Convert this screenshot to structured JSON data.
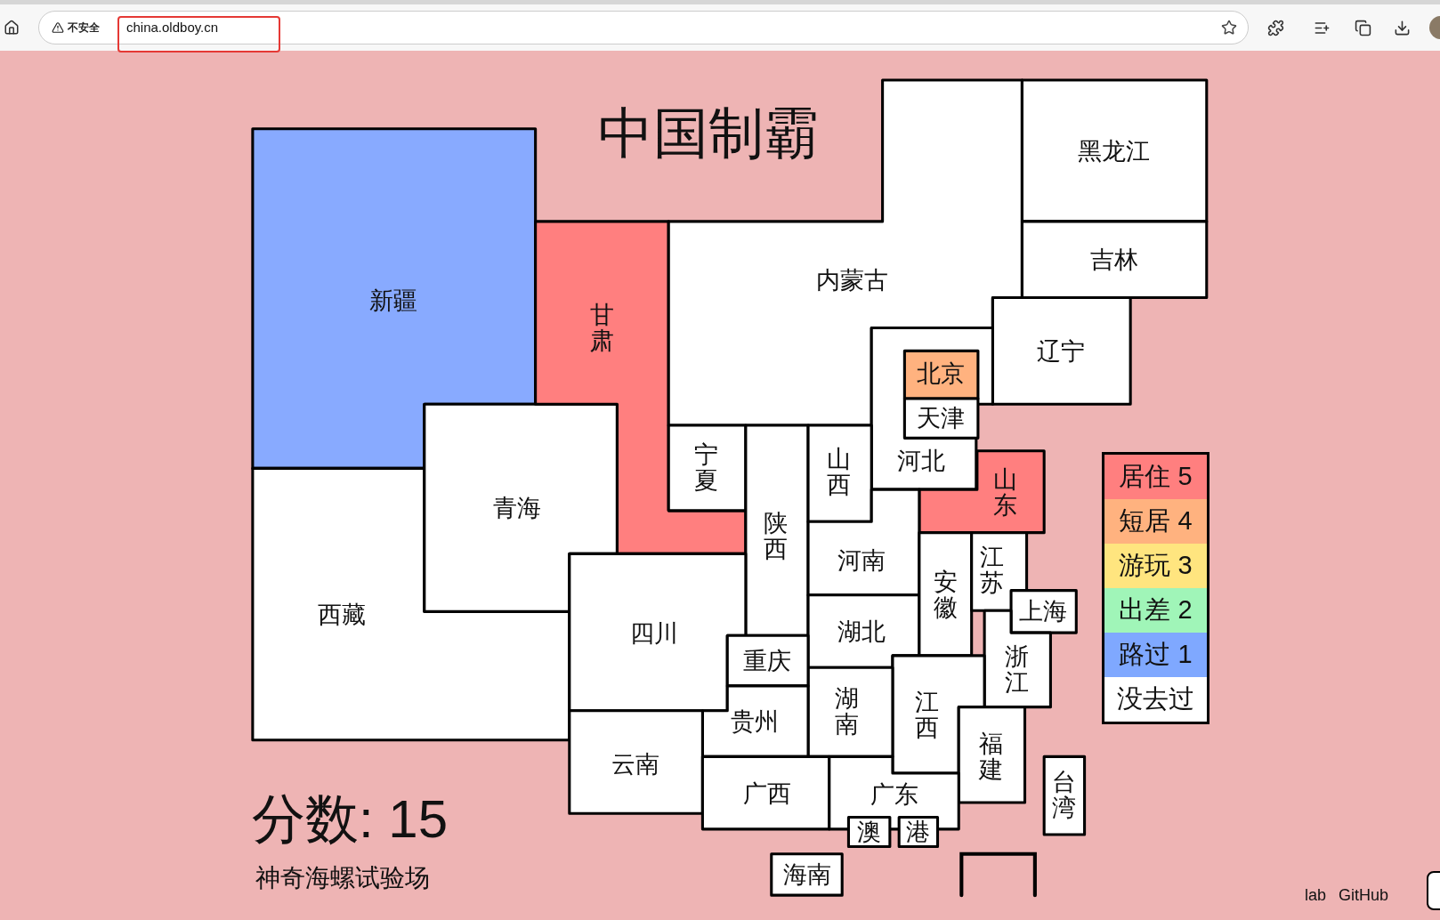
{
  "browser": {
    "security_label": "不安全",
    "url": "china.oldboy.cn"
  },
  "title": "中国制霸",
  "provinces": [
    {
      "name": "新疆",
      "color": "#88aaff"
    },
    {
      "name": "西藏",
      "color": "#ffffff"
    },
    {
      "name": "青海",
      "color": "#ffffff"
    },
    {
      "name": "甘肃",
      "color": "#ff7f7f"
    },
    {
      "name": "内蒙古",
      "color": "#ffffff"
    },
    {
      "name": "黑龙江",
      "color": "#ffffff"
    },
    {
      "name": "吉林",
      "color": "#ffffff"
    },
    {
      "name": "辽宁",
      "color": "#ffffff"
    },
    {
      "name": "河北",
      "color": "#ffffff"
    },
    {
      "name": "北京",
      "color": "#ffb27f"
    },
    {
      "name": "天津",
      "color": "#ffffff"
    },
    {
      "name": "山东",
      "color": "#ff7f7f"
    },
    {
      "name": "宁夏",
      "color": "#ffffff"
    },
    {
      "name": "陕西",
      "color": "#ffffff"
    },
    {
      "name": "山西",
      "color": "#ffffff"
    },
    {
      "name": "河南",
      "color": "#ffffff"
    },
    {
      "name": "湖北",
      "color": "#ffffff"
    },
    {
      "name": "安徽",
      "color": "#ffffff"
    },
    {
      "name": "江苏",
      "color": "#ffffff"
    },
    {
      "name": "上海",
      "color": "#ffffff"
    },
    {
      "name": "浙江",
      "color": "#ffffff"
    },
    {
      "name": "江西",
      "color": "#ffffff"
    },
    {
      "name": "福建",
      "color": "#ffffff"
    },
    {
      "name": "台湾",
      "color": "#ffffff"
    },
    {
      "name": "湖南",
      "color": "#ffffff"
    },
    {
      "name": "四川",
      "color": "#ffffff"
    },
    {
      "name": "重庆",
      "color": "#ffffff"
    },
    {
      "name": "贵州",
      "color": "#ffffff"
    },
    {
      "name": "云南",
      "color": "#ffffff"
    },
    {
      "name": "广西",
      "color": "#ffffff"
    },
    {
      "name": "广东",
      "color": "#ffffff"
    },
    {
      "name": "澳",
      "color": "#ffffff"
    },
    {
      "name": "港",
      "color": "#ffffff"
    },
    {
      "name": "海南",
      "color": "#ffffff"
    }
  ],
  "legend": [
    {
      "label": "居住 5",
      "color": "#ff7f7f"
    },
    {
      "label": "短居 4",
      "color": "#ffb27f"
    },
    {
      "label": "游玩 3",
      "color": "#ffe57f"
    },
    {
      "label": "出差 2",
      "color": "#a0f5b8"
    },
    {
      "label": "路过 1",
      "color": "#7fa8ff"
    },
    {
      "label": "没去过",
      "color": "#ffffff"
    }
  ],
  "score": "分数: 15",
  "subtitle": "神奇海螺试验场",
  "footer_links": [
    "lab",
    "GitHub"
  ]
}
